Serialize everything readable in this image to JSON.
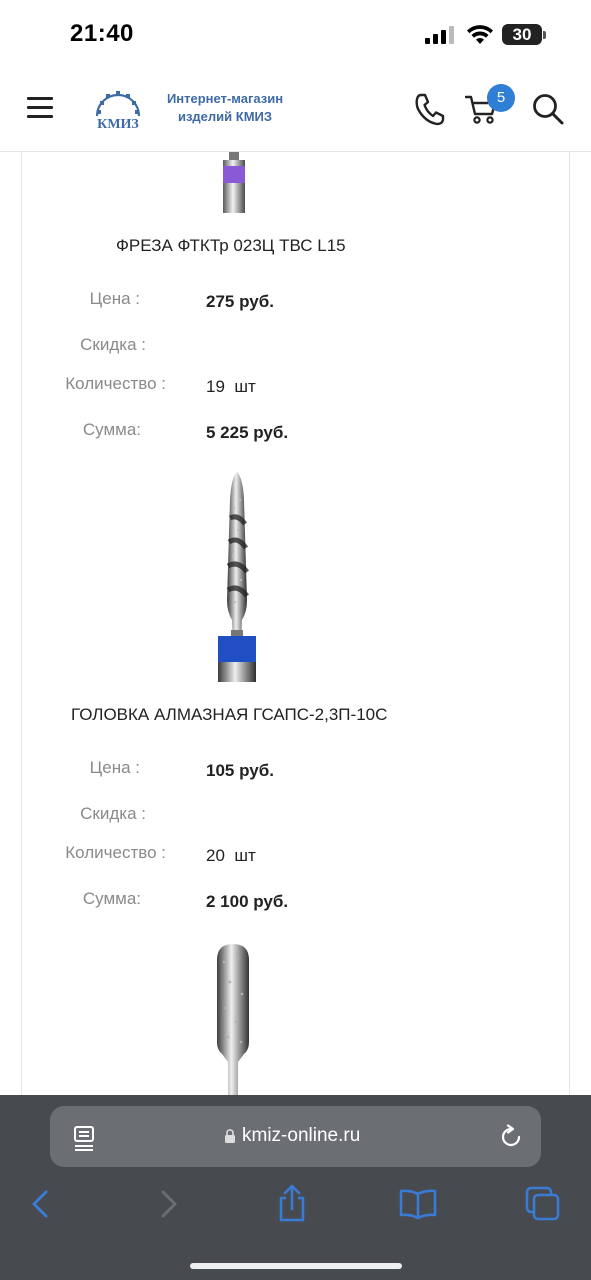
{
  "status_bar": {
    "time": "21:40",
    "battery": "30",
    "icons": [
      "signal-icon",
      "wifi-icon",
      "battery-icon"
    ]
  },
  "header": {
    "logo_abbr": "КМИЗ",
    "logo_line1": "Интернет-магазин",
    "logo_line2": "изделий КМИЗ",
    "cart_count": "5",
    "icons": [
      "menu-icon",
      "phone-icon",
      "cart-icon",
      "search-icon"
    ],
    "accent_color": "#2f7fd6"
  },
  "labels": {
    "price": "Цена :",
    "discount": "Скидка :",
    "quantity": "Количество :",
    "sum": "Сумма:"
  },
  "items": [
    {
      "name": "ФРЕЗА ФТКТр 023Ц ТВС L15",
      "price": "275 руб.",
      "discount": "",
      "quantity": "19",
      "unit": "шт",
      "sum": "5 225 руб.",
      "band_color": "#8a5ad6"
    },
    {
      "name": "ГОЛОВКА АЛМАЗНАЯ ГСАПС-2,3П-10С",
      "price": "105 руб.",
      "discount": "",
      "quantity": "20",
      "unit": "шт",
      "sum": "2 100 руб.",
      "band_color": "#1f4fc2"
    }
  ],
  "browser": {
    "url": "kmiz-online.ru",
    "icons": [
      "reader-icon",
      "lock-icon",
      "reload-icon",
      "back-icon",
      "forward-icon",
      "share-icon",
      "bookmarks-icon",
      "tabs-icon"
    ],
    "toolbar_color": "#3a7bd5"
  }
}
